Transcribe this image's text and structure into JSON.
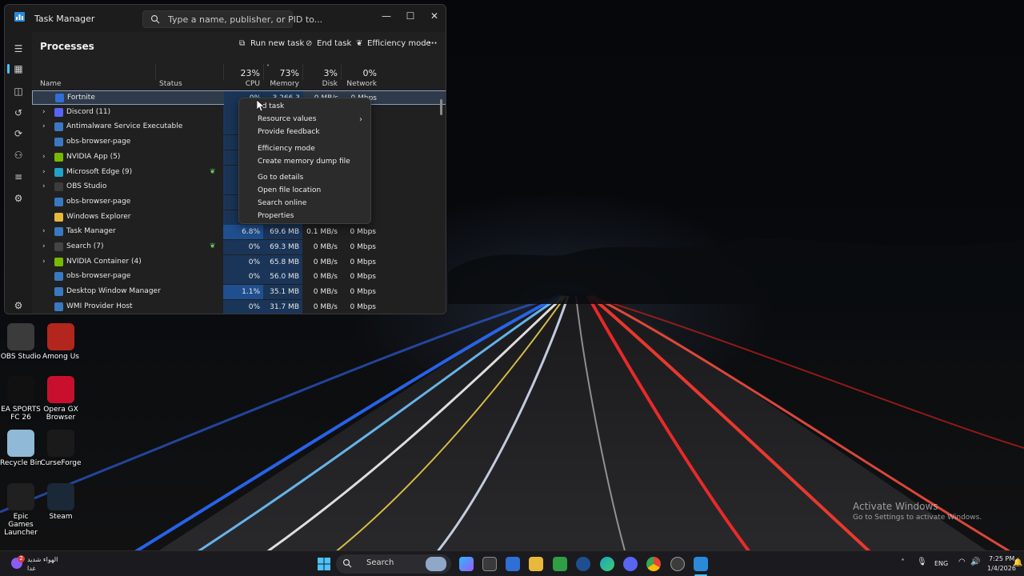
{
  "window": {
    "title": "Task Manager",
    "search_placeholder": "Type a name, publisher, or PID to...",
    "minimize": "—",
    "maximize": "☐",
    "close": "✕"
  },
  "toolbar": {
    "heading": "Processes",
    "run_new_task": "Run new task",
    "end_task": "End task",
    "efficiency_mode": "Efficiency mode",
    "more": "···"
  },
  "columns": {
    "name": "Name",
    "status": "Status",
    "cpu_pct": "23%",
    "cpu": "CPU",
    "mem_pct": "73%",
    "memory": "Memory",
    "disk_pct": "3%",
    "disk": "Disk",
    "net_pct": "0%",
    "network": "Network"
  },
  "processes": [
    {
      "name": "Fortnite",
      "expandable": false,
      "icon": "fortnite-icon",
      "color": "#2f6fd6",
      "cpu": "0%",
      "mem": "3,266.3 MB",
      "disk": "0 MB/s",
      "net": "0 Mbps"
    },
    {
      "name": "Discord (11)",
      "expandable": true,
      "icon": "discord-icon",
      "color": "#5865f2",
      "cpu": "",
      "mem": "",
      "disk": "",
      "net": ""
    },
    {
      "name": "Antimalware Service Executable",
      "expandable": true,
      "icon": "shield-app-icon",
      "color": "#3a78c2",
      "cpu": "",
      "mem": "",
      "disk": "",
      "net": ""
    },
    {
      "name": "obs-browser-page",
      "expandable": false,
      "icon": "window-app-icon",
      "color": "#3a78c2",
      "cpu": "",
      "mem": "",
      "disk": "",
      "net": ""
    },
    {
      "name": "NVIDIA App (5)",
      "expandable": true,
      "icon": "nvidia-icon",
      "color": "#76b900",
      "cpu": "",
      "mem": "",
      "disk": "",
      "net": ""
    },
    {
      "name": "Microsoft Edge (9)",
      "expandable": true,
      "icon": "edge-icon",
      "color": "#1fa3c7",
      "cpu": "",
      "mem": "",
      "disk": "",
      "net": "",
      "eco": true
    },
    {
      "name": "OBS Studio",
      "expandable": true,
      "icon": "obs-icon",
      "color": "#3c3c3c",
      "cpu": "",
      "mem": "",
      "disk": "",
      "net": ""
    },
    {
      "name": "obs-browser-page",
      "expandable": false,
      "icon": "window-app-icon",
      "color": "#3a78c2",
      "cpu": "",
      "mem": "",
      "disk": "",
      "net": ""
    },
    {
      "name": "Windows Explorer",
      "expandable": false,
      "icon": "folder-icon",
      "color": "#e8b93a",
      "cpu": "",
      "mem": "",
      "disk": "",
      "net": ""
    },
    {
      "name": "Task Manager",
      "expandable": true,
      "icon": "task-manager-icon",
      "color": "#3a78c2",
      "cpu": "6.8%",
      "mem": "69.6 MB",
      "disk": "0.1 MB/s",
      "net": "0 Mbps"
    },
    {
      "name": "Search (7)",
      "expandable": true,
      "icon": "search-app-icon",
      "color": "#444444",
      "cpu": "0%",
      "mem": "69.3 MB",
      "disk": "0 MB/s",
      "net": "0 Mbps",
      "eco": true
    },
    {
      "name": "NVIDIA Container (4)",
      "expandable": true,
      "icon": "nvidia-icon",
      "color": "#76b900",
      "cpu": "0%",
      "mem": "65.8 MB",
      "disk": "0 MB/s",
      "net": "0 Mbps"
    },
    {
      "name": "obs-browser-page",
      "expandable": false,
      "icon": "window-app-icon",
      "color": "#3a78c2",
      "cpu": "0%",
      "mem": "56.0 MB",
      "disk": "0 MB/s",
      "net": "0 Mbps"
    },
    {
      "name": "Desktop Window Manager",
      "expandable": false,
      "icon": "window-app-icon",
      "color": "#3a78c2",
      "cpu": "1.1%",
      "mem": "35.1 MB",
      "disk": "0 MB/s",
      "net": "0 Mbps"
    },
    {
      "name": "WMI Provider Host",
      "expandable": false,
      "icon": "window-app-icon",
      "color": "#3a78c2",
      "cpu": "0%",
      "mem": "31.7 MB",
      "disk": "0 MB/s",
      "net": "0 Mbps"
    }
  ],
  "context_menu": {
    "end_task": "nd task",
    "resource_values": "Resource values",
    "provide_feedback": "Provide feedback",
    "efficiency_mode": "Efficiency mode",
    "create_dump": "Create memory dump file",
    "go_to_details": "Go to details",
    "open_file_location": "Open file location",
    "search_online": "Search online",
    "properties": "Properties"
  },
  "desktop_icons": [
    {
      "label": "OBS Studio",
      "color": "#3b3b3b"
    },
    {
      "label": "Among Us",
      "color": "#b3261e"
    },
    {
      "label": "EA SPORTS FC 26",
      "color": "#111111"
    },
    {
      "label": "Opera GX Browser",
      "color": "#c8102e"
    },
    {
      "label": "Recycle Bin",
      "color": "#8fb9d6"
    },
    {
      "label": "CurseForge",
      "color": "#1a1a1a"
    },
    {
      "label": "Epic Games Launcher",
      "color": "#202020"
    },
    {
      "label": "Steam",
      "color": "#1b2838"
    }
  ],
  "activation": {
    "line1": "Activate Windows",
    "line2": "Go to Settings to activate Windows."
  },
  "taskbar": {
    "weather_line1": "الهواء شديد",
    "weather_line2": "غدا",
    "weather_badge": "2",
    "search_label": "Search",
    "language": "ENG",
    "time": "7:25 PM",
    "date": "1/4/2026"
  }
}
